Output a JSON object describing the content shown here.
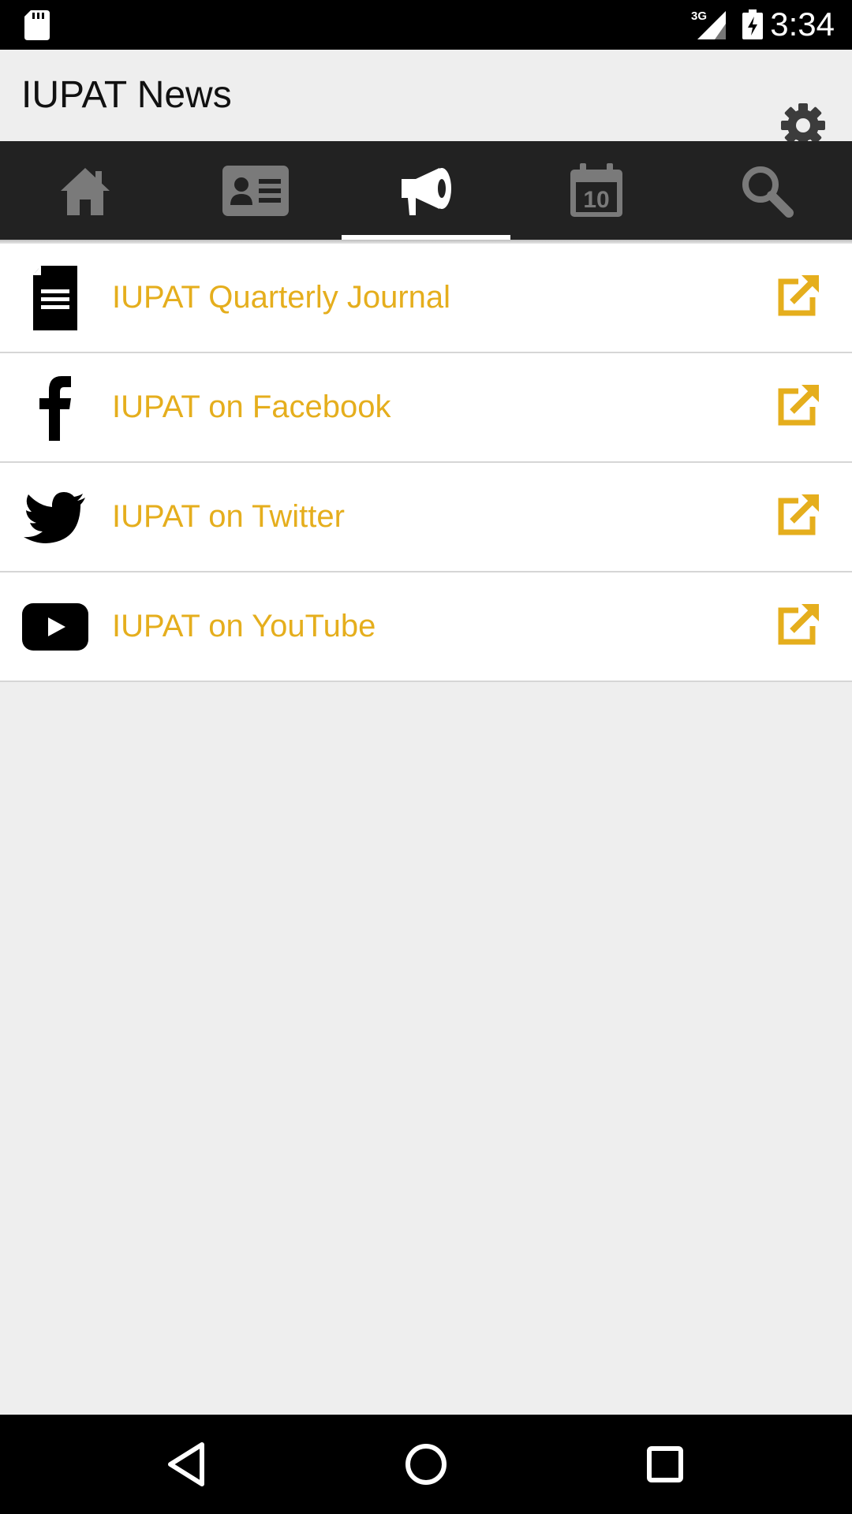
{
  "status_bar": {
    "time": "3:34",
    "network": "3G",
    "icons": [
      "sd-card-icon",
      "signal-icon",
      "battery-charging-icon"
    ]
  },
  "app_bar": {
    "title": "IUPAT News",
    "action_icon": "gear-icon"
  },
  "tabs": [
    {
      "icon": "home-icon",
      "active": false
    },
    {
      "icon": "contact-card-icon",
      "active": false
    },
    {
      "icon": "megaphone-icon",
      "active": true
    },
    {
      "icon": "calendar-icon",
      "active": false,
      "text": "10"
    },
    {
      "icon": "search-icon",
      "active": false
    }
  ],
  "list": {
    "items": [
      {
        "label": "IUPAT Quarterly Journal",
        "icon": "document-icon",
        "action_icon": "external-link-icon"
      },
      {
        "label": "IUPAT on Facebook",
        "icon": "facebook-icon",
        "action_icon": "external-link-icon"
      },
      {
        "label": "IUPAT on Twitter",
        "icon": "twitter-icon",
        "action_icon": "external-link-icon"
      },
      {
        "label": "IUPAT on YouTube",
        "icon": "youtube-icon",
        "action_icon": "external-link-icon"
      }
    ]
  },
  "nav_bar": {
    "buttons": [
      "back-icon",
      "home-circle-icon",
      "recents-icon"
    ]
  },
  "colors": {
    "accent": "#e5ae1d",
    "tab_bar": "#222222",
    "tab_inactive": "#7a7a7a",
    "background": "#eeeeee"
  }
}
